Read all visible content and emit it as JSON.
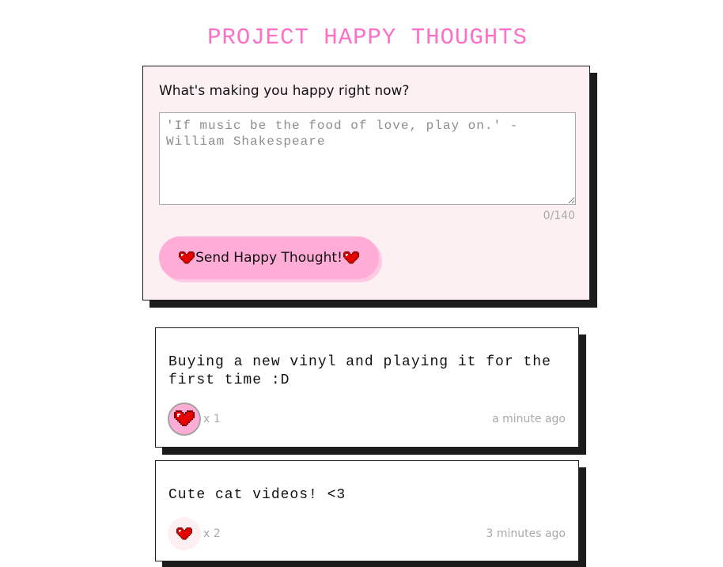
{
  "header": {
    "title": "PROJECT HAPPY THOUGHTS"
  },
  "form": {
    "label": "What's making you happy right now?",
    "input_value": "",
    "input_placeholder": "'If music be the food of love, play on.' - William Shakespeare",
    "char_count": "0/140",
    "submit_label": "Send Happy Thought!",
    "submit_icon": "heart-icon"
  },
  "thoughts": [
    {
      "message": "Buying a new vinyl and playing it for the first time :D",
      "like_icon": "heart-icon",
      "likes": "x 1",
      "liked": true,
      "time": "a minute ago"
    },
    {
      "message": "Cute cat videos! <3",
      "like_icon": "heart-icon",
      "likes": "x 2",
      "liked": false,
      "time": "3 minutes ago"
    }
  ],
  "colors": {
    "title": "#ff6fc8",
    "button": "#ffadd6",
    "form_background": "#fdf0f3",
    "shadow": "#1c1c1c",
    "heart": "#e60000"
  }
}
